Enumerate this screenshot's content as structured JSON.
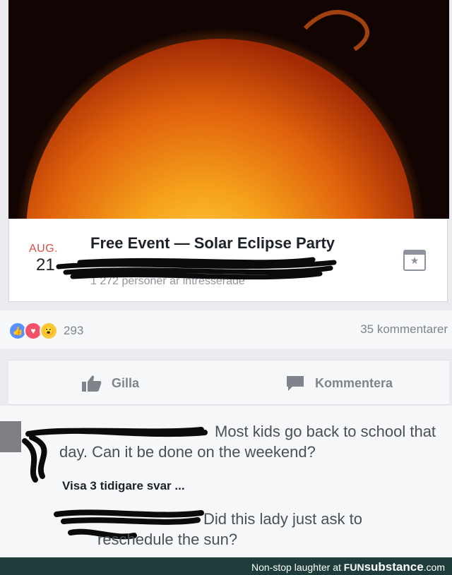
{
  "event": {
    "month": "AUG.",
    "day": "21",
    "title": "Free Event — Solar Eclipse Party",
    "interested": "1 272 personer är intresserade"
  },
  "reactions": {
    "icons": [
      "like-reaction",
      "love-reaction",
      "wow-reaction"
    ],
    "count": "293",
    "comments": "35 kommentarer"
  },
  "actions": {
    "like_label": "Gilla",
    "comment_label": "Kommentera"
  },
  "comments": {
    "first_text": "Most kids go back to school that day. Can it be done on the weekend?",
    "show_replies": "Visa 3 tidigare svar ...",
    "reply_text": "Did this lady just ask to reschedule the sun?"
  },
  "footer": {
    "prefix": "Non-stop laughter at ",
    "brand_fun": "FUN",
    "brand_rest": "substance",
    "brand_tld": ".com"
  },
  "colors": {
    "month_accent": "#e04a4a",
    "like_blue": "#5890ff",
    "love_red": "#f25268",
    "footer_bg": "#1f3d3a"
  }
}
